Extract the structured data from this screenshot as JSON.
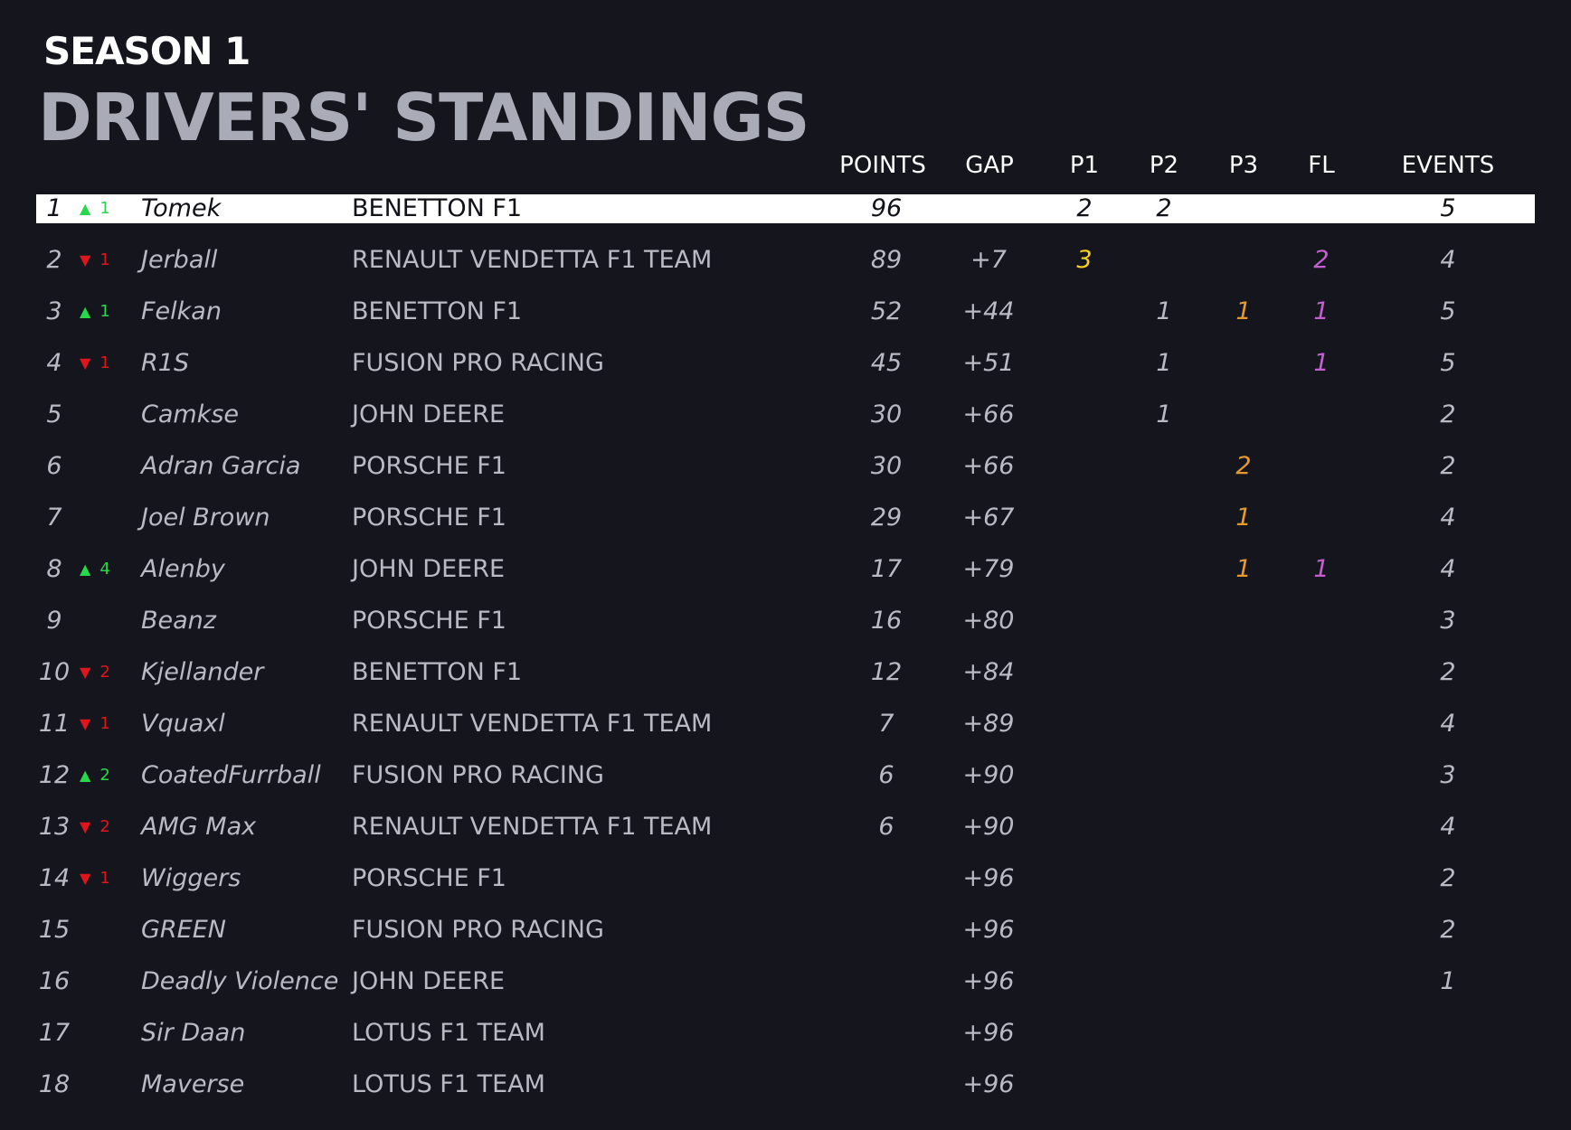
{
  "header": {
    "season": "SEASON 1",
    "title": "DRIVERS' STANDINGS"
  },
  "columns": {
    "points": "POINTS",
    "gap": "GAP",
    "p1": "P1",
    "p2": "P2",
    "p3": "P3",
    "fl": "FL",
    "events": "EVENTS"
  },
  "colors": {
    "background": "#15161d",
    "leader_row": "#ffffff",
    "up": "#27d94a",
    "down": "#e0151b",
    "p1": "#f5d01c",
    "p3": "#e69a2c",
    "fastest_lap": "#c45fd0"
  },
  "standings": [
    {
      "pos": "1",
      "dir": "up",
      "change": "1",
      "driver": "Tomek",
      "team": "BENETTON F1",
      "points": "96",
      "gap": "",
      "p1": "2",
      "p2": "2",
      "p3": "",
      "fl": "",
      "events": "5"
    },
    {
      "pos": "2",
      "dir": "down",
      "change": "1",
      "driver": "Jerball",
      "team": "RENAULT VENDETTA F1 TEAM",
      "points": "89",
      "gap": "+7",
      "p1": "3",
      "p2": "",
      "p3": "",
      "fl": "2",
      "events": "4"
    },
    {
      "pos": "3",
      "dir": "up",
      "change": "1",
      "driver": "Felkan",
      "team": "BENETTON F1",
      "points": "52",
      "gap": "+44",
      "p1": "",
      "p2": "1",
      "p3": "1",
      "fl": "1",
      "events": "5"
    },
    {
      "pos": "4",
      "dir": "down",
      "change": "1",
      "driver": "R1S",
      "team": "FUSION PRO RACING",
      "points": "45",
      "gap": "+51",
      "p1": "",
      "p2": "1",
      "p3": "",
      "fl": "1",
      "events": "5"
    },
    {
      "pos": "5",
      "dir": "",
      "change": "",
      "driver": "Camkse",
      "team": "JOHN DEERE",
      "points": "30",
      "gap": "+66",
      "p1": "",
      "p2": "1",
      "p3": "",
      "fl": "",
      "events": "2"
    },
    {
      "pos": "6",
      "dir": "",
      "change": "",
      "driver": "Adran Garcia",
      "team": "PORSCHE F1",
      "points": "30",
      "gap": "+66",
      "p1": "",
      "p2": "",
      "p3": "2",
      "fl": "",
      "events": "2"
    },
    {
      "pos": "7",
      "dir": "",
      "change": "",
      "driver": "Joel Brown",
      "team": "PORSCHE F1",
      "points": "29",
      "gap": "+67",
      "p1": "",
      "p2": "",
      "p3": "1",
      "fl": "",
      "events": "4"
    },
    {
      "pos": "8",
      "dir": "up",
      "change": "4",
      "driver": "Alenby",
      "team": "JOHN DEERE",
      "points": "17",
      "gap": "+79",
      "p1": "",
      "p2": "",
      "p3": "1",
      "fl": "1",
      "events": "4"
    },
    {
      "pos": "9",
      "dir": "",
      "change": "",
      "driver": "Beanz",
      "team": "PORSCHE F1",
      "points": "16",
      "gap": "+80",
      "p1": "",
      "p2": "",
      "p3": "",
      "fl": "",
      "events": "3"
    },
    {
      "pos": "10",
      "dir": "down",
      "change": "2",
      "driver": "Kjellander",
      "team": "BENETTON F1",
      "points": "12",
      "gap": "+84",
      "p1": "",
      "p2": "",
      "p3": "",
      "fl": "",
      "events": "2"
    },
    {
      "pos": "11",
      "dir": "down",
      "change": "1",
      "driver": "Vquaxl",
      "team": "RENAULT VENDETTA F1 TEAM",
      "points": "7",
      "gap": "+89",
      "p1": "",
      "p2": "",
      "p3": "",
      "fl": "",
      "events": "4"
    },
    {
      "pos": "12",
      "dir": "up",
      "change": "2",
      "driver": "CoatedFurrball",
      "team": "FUSION PRO RACING",
      "points": "6",
      "gap": "+90",
      "p1": "",
      "p2": "",
      "p3": "",
      "fl": "",
      "events": "3"
    },
    {
      "pos": "13",
      "dir": "down",
      "change": "2",
      "driver": "AMG Max",
      "team": "RENAULT VENDETTA F1 TEAM",
      "points": "6",
      "gap": "+90",
      "p1": "",
      "p2": "",
      "p3": "",
      "fl": "",
      "events": "4"
    },
    {
      "pos": "14",
      "dir": "down",
      "change": "1",
      "driver": "Wiggers",
      "team": "PORSCHE F1",
      "points": "",
      "gap": "+96",
      "p1": "",
      "p2": "",
      "p3": "",
      "fl": "",
      "events": "2"
    },
    {
      "pos": "15",
      "dir": "",
      "change": "",
      "driver": "GREEN",
      "team": "FUSION PRO RACING",
      "points": "",
      "gap": "+96",
      "p1": "",
      "p2": "",
      "p3": "",
      "fl": "",
      "events": "2"
    },
    {
      "pos": "16",
      "dir": "",
      "change": "",
      "driver": "Deadly Violence",
      "team": "JOHN DEERE",
      "points": "",
      "gap": "+96",
      "p1": "",
      "p2": "",
      "p3": "",
      "fl": "",
      "events": "1"
    },
    {
      "pos": "17",
      "dir": "",
      "change": "",
      "driver": "Sir Daan",
      "team": "LOTUS F1 TEAM",
      "points": "",
      "gap": "+96",
      "p1": "",
      "p2": "",
      "p3": "",
      "fl": "",
      "events": ""
    },
    {
      "pos": "18",
      "dir": "",
      "change": "",
      "driver": "Maverse",
      "team": "LOTUS F1 TEAM",
      "points": "",
      "gap": "+96",
      "p1": "",
      "p2": "",
      "p3": "",
      "fl": "",
      "events": ""
    }
  ]
}
